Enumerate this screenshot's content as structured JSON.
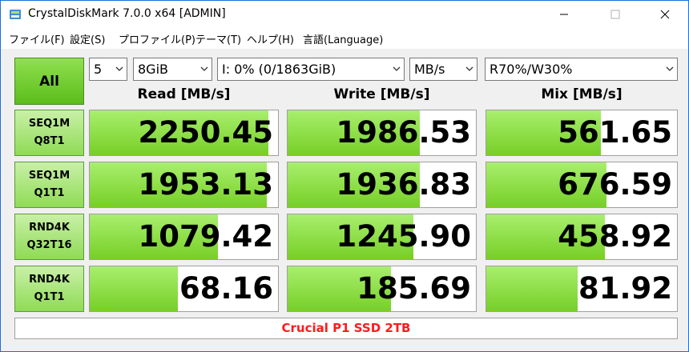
{
  "window": {
    "title": "CrystalDiskMark 7.0.0 x64 [ADMIN]",
    "buttons": [
      "minimize",
      "maximize",
      "close"
    ]
  },
  "menu": [
    "ファイル(F)",
    "設定(S)",
    "プロファイル(P)",
    "テーマ(T)",
    "ヘルプ(H)",
    "言語(Language)"
  ],
  "controls": {
    "all_label": "All",
    "count": "5",
    "size": "8GiB",
    "drive": "I: 0% (0/1863GiB)",
    "unit": "MB/s",
    "mix": "R70%/W30%"
  },
  "headers": {
    "read": "Read [MB/s]",
    "write": "Write [MB/s]",
    "mix": "Mix [MB/s]"
  },
  "rows": [
    {
      "line1": "SEQ1M",
      "line2": "Q8T1",
      "read": "2250.45",
      "write": "1986.53",
      "mix": "561.65",
      "read_fill": 0.95,
      "write_fill": 0.7,
      "mix_fill": 0.6
    },
    {
      "line1": "SEQ1M",
      "line2": "Q1T1",
      "read": "1953.13",
      "write": "1936.83",
      "mix": "676.59",
      "read_fill": 0.94,
      "write_fill": 0.7,
      "mix_fill": 0.63
    },
    {
      "line1": "RND4K",
      "line2": "Q32T16",
      "read": "1079.42",
      "write": "1245.90",
      "mix": "458.92",
      "read_fill": 0.68,
      "write_fill": 0.67,
      "mix_fill": 0.62
    },
    {
      "line1": "RND4K",
      "line2": "Q1T1",
      "read": "68.16",
      "write": "185.69",
      "mix": "81.92",
      "read_fill": 0.47,
      "write_fill": 0.55,
      "mix_fill": 0.48
    }
  ],
  "footer": {
    "text": "Crucial P1 SSD 2TB",
    "color": "#ff1a1a"
  },
  "colors": {
    "accent_green": "#77cf26",
    "window_border": "#1e6fd9"
  }
}
